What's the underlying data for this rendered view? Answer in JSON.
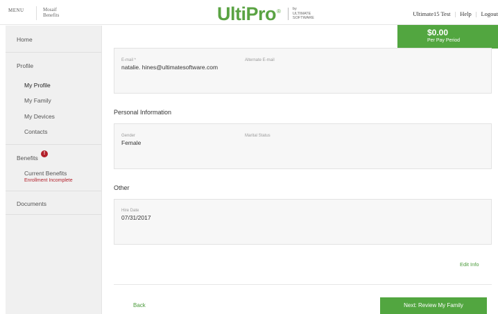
{
  "header": {
    "menu_label": "MENU",
    "brand_line1": "Mosaif",
    "brand_line2": "Benefits",
    "logo_text": "UltiPro",
    "logo_mark": "®",
    "logo_by": "by",
    "logo_line1": "ULTIMATE",
    "logo_line2": "SOFTWARE",
    "user_name": "Ultimate15 Test",
    "help_label": "Help",
    "logout_label": "Logout"
  },
  "cost": {
    "amount": "$0.00",
    "label": "Per Pay Period"
  },
  "sidebar": {
    "home": "Home",
    "profile": "Profile",
    "profile_items": [
      "My Profile",
      "My Family",
      "My Devices",
      "Contacts"
    ],
    "benefits": "Benefits",
    "benefits_alert": "!",
    "current_benefits": "Current Benefits",
    "enrollment_status": "Enrollment Incomplete",
    "documents": "Documents"
  },
  "contact": {
    "email_label": "E-mail *",
    "email_value": "natalie. hines@ultimatesoftware.com",
    "alt_email_label": "Alternate E-mail"
  },
  "personal": {
    "title": "Personal Information",
    "gender_label": "Gender",
    "gender_value": "Female",
    "marital_label": "Marital Status"
  },
  "other": {
    "title": "Other",
    "hire_label": "Hire Date",
    "hire_value": "07/31/2017"
  },
  "actions": {
    "edit_info": "Edit Info",
    "back": "Back",
    "next": "Next: Review My Family"
  },
  "colors": {
    "accent_green": "#52a640",
    "alert_red": "#b21f2a"
  }
}
